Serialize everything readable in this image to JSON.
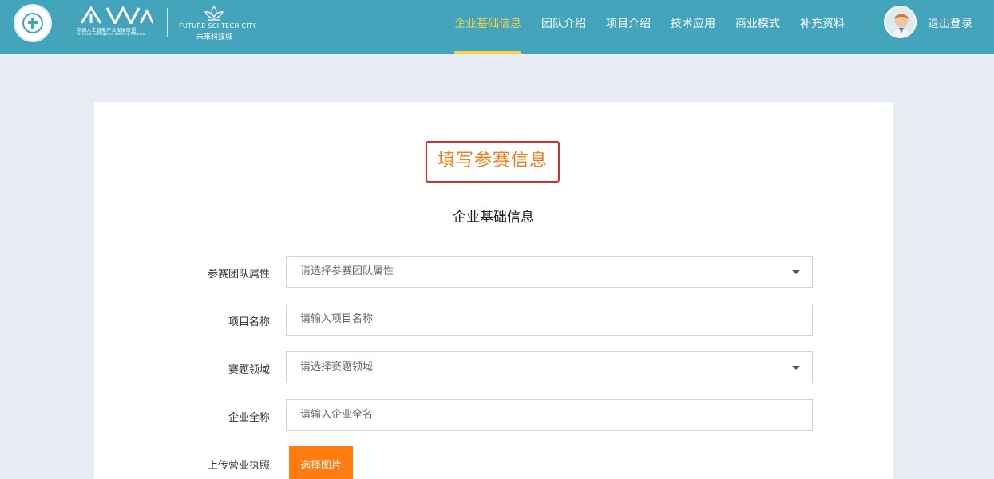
{
  "header": {
    "aiia_cn": "中国人工智能产业发展联盟",
    "aiia_en": "Artificial Intelligence Industry Alliance",
    "future_en": "FUTURE SCI-TECH CITY",
    "future_cn": "未来科技城",
    "nav": [
      {
        "label": "企业基础信息",
        "active": true
      },
      {
        "label": "团队介绍"
      },
      {
        "label": "项目介绍"
      },
      {
        "label": "技术应用"
      },
      {
        "label": "商业模式"
      },
      {
        "label": "补充资料"
      }
    ],
    "logout": "退出登录"
  },
  "form": {
    "title": "填写参赛信息",
    "section": "企业基础信息",
    "fields": [
      {
        "label": "参赛团队属性",
        "placeholder": "请选择参赛团队属性",
        "type": "select"
      },
      {
        "label": "项目名称",
        "placeholder": "请输入项目名称",
        "type": "input"
      },
      {
        "label": "赛题领域",
        "placeholder": "请选择赛题领域",
        "type": "select"
      },
      {
        "label": "企业全称",
        "placeholder": "请输入企业全名",
        "type": "input"
      }
    ],
    "upload_label": "上传营业执照",
    "upload_button": "选择图片"
  },
  "colors": {
    "header_bg": "#43a4bc",
    "active_nav": "#f9d24b",
    "title_text": "#ee7d1a",
    "title_border": "#e02a2a",
    "upload_button_bg": "#ff7c10",
    "page_bg": "#e7ebf4"
  }
}
